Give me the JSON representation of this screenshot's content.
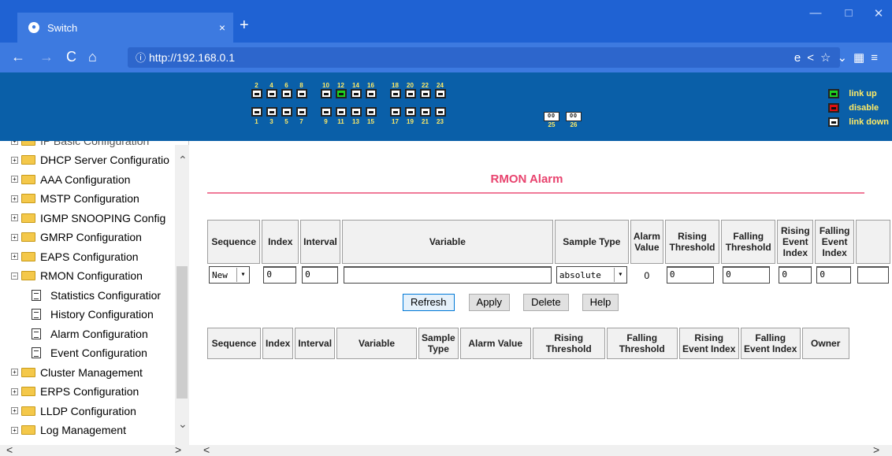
{
  "browser": {
    "tab_title": "Switch",
    "tab_close": "×",
    "new_tab": "+",
    "url": "http://192.168.0.1",
    "win_min": "—",
    "win_max": "□",
    "win_close": "✕"
  },
  "banner": {
    "top_labels": [
      [
        "2",
        "4",
        "6",
        "8"
      ],
      [
        "10",
        "12",
        "14",
        "16"
      ],
      [
        "18",
        "20",
        "22",
        "24"
      ]
    ],
    "bottom_labels": [
      [
        "1",
        "3",
        "5",
        "7"
      ],
      [
        "9",
        "11",
        "13",
        "15"
      ],
      [
        "17",
        "19",
        "21",
        "23"
      ]
    ],
    "sfp_labels": [
      "25",
      "26"
    ],
    "link_up_port": "12",
    "legend": {
      "link_up": "link up",
      "disable": "disable",
      "link_down": "link down"
    },
    "colors": {
      "link_up": "#1fd11f",
      "disable": "#e01010",
      "link_down": "#ffffff"
    }
  },
  "sidebar": {
    "partial_item": "IP Basic Configuration",
    "items": [
      {
        "label": "DHCP Server Configuratio",
        "type": "folder"
      },
      {
        "label": "AAA Configuration",
        "type": "folder"
      },
      {
        "label": "MSTP Configuration",
        "type": "folder"
      },
      {
        "label": "IGMP SNOOPING Config",
        "type": "folder"
      },
      {
        "label": "GMRP Configuration",
        "type": "folder"
      },
      {
        "label": "EAPS Configuration",
        "type": "folder"
      },
      {
        "label": "RMON Configuration",
        "type": "open-folder"
      },
      {
        "label": "Statistics Configuratior",
        "type": "doc"
      },
      {
        "label": "History Configuration",
        "type": "doc"
      },
      {
        "label": "Alarm Configuration",
        "type": "doc"
      },
      {
        "label": "Event Configuration",
        "type": "doc"
      },
      {
        "label": "Cluster Management",
        "type": "folder"
      },
      {
        "label": "ERPS Configuration",
        "type": "folder"
      },
      {
        "label": "LLDP Configuration",
        "type": "folder"
      },
      {
        "label": "Log Management",
        "type": "folder"
      }
    ]
  },
  "page": {
    "title": "RMON Alarm",
    "config_headers": [
      "Sequence",
      "Index",
      "Interval",
      "Variable",
      "Sample Type",
      "Alarm Value",
      "Rising Threshold",
      "Falling Threshold",
      "Rising Event Index",
      "Falling Event Index",
      ""
    ],
    "inputs": {
      "sequence": "New",
      "index": "0",
      "interval": "0",
      "variable": "",
      "sample_type": "absolute",
      "alarm_value": "0",
      "rising_threshold": "0",
      "falling_threshold": "0",
      "rising_event_index": "0",
      "falling_event_index": "0",
      "owner": ""
    },
    "buttons": {
      "refresh": "Refresh",
      "apply": "Apply",
      "delete": "Delete",
      "help": "Help"
    },
    "list_headers": [
      "Sequence",
      "Index",
      "Interval",
      "Variable",
      "Sample Type",
      "Alarm Value",
      "Rising Threshold",
      "Falling Threshold",
      "Rising Event Index",
      "Falling Event Index",
      "Owner"
    ]
  }
}
